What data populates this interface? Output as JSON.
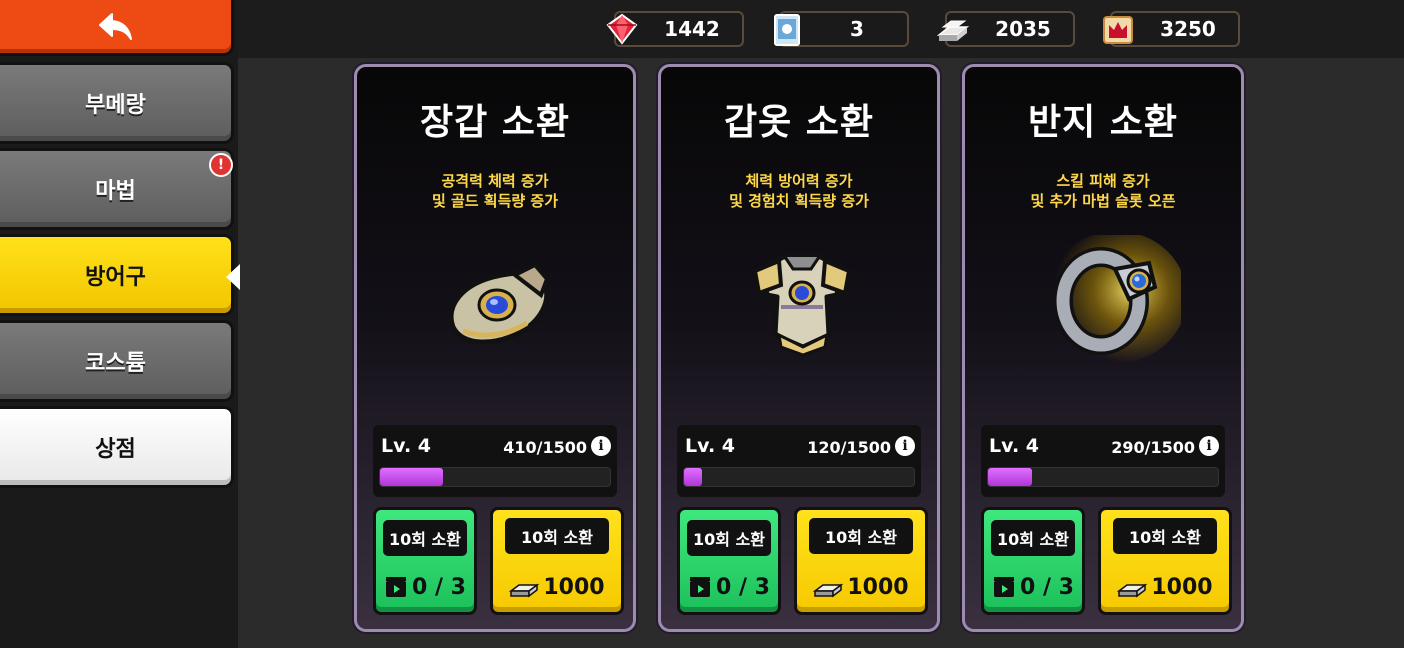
{
  "sidebar": {
    "back_icon": "back-arrow-icon",
    "tabs": [
      {
        "label": "부메랑",
        "style": "gray",
        "alert": false
      },
      {
        "label": "마법",
        "style": "gray",
        "alert": true,
        "alert_text": "!"
      },
      {
        "label": "방어구",
        "style": "yellow",
        "alert": false
      },
      {
        "label": "코스튬",
        "style": "gray",
        "alert": false
      },
      {
        "label": "상점",
        "style": "white",
        "alert": false
      }
    ]
  },
  "currencies": [
    {
      "icon": "red-gem-icon",
      "value": "1442"
    },
    {
      "icon": "summon-ticket-icon",
      "value": "3"
    },
    {
      "icon": "silver-ingot-icon",
      "value": "2035"
    },
    {
      "icon": "crown-ticket-icon",
      "value": "3250"
    }
  ],
  "cards": [
    {
      "title": "장갑 소환",
      "desc_line1": "공격력 체력 증가",
      "desc_line2": "및 골드 획득량 증가",
      "art_icon": "gauntlet-icon",
      "level": "Lv. 4",
      "progress": "410/1500",
      "progress_fraction": 0.273,
      "ad_button_label": "10회 소환",
      "ad_count": "0 / 3",
      "buy_button_label": "10회 소환",
      "buy_cost": "1000"
    },
    {
      "title": "갑옷 소환",
      "desc_line1": "체력 방어력 증가",
      "desc_line2": "및 경험치 획득량 증가",
      "art_icon": "armor-icon",
      "level": "Lv. 4",
      "progress": "120/1500",
      "progress_fraction": 0.08,
      "ad_button_label": "10회 소환",
      "ad_count": "0 / 3",
      "buy_button_label": "10회 소환",
      "buy_cost": "1000"
    },
    {
      "title": "반지 소환",
      "desc_line1": "스킬 피해 증가",
      "desc_line2": "및 추가 마법 슬롯 오픈",
      "art_icon": "ring-icon",
      "level": "Lv. 4",
      "progress": "290/1500",
      "progress_fraction": 0.193,
      "ad_button_label": "10회 소환",
      "ad_count": "0 / 3",
      "buy_button_label": "10회 소환",
      "buy_cost": "1000"
    }
  ],
  "colors": {
    "back_button": "#ee4a14",
    "selected_tab": "#f2c500",
    "card_border": "#9d8bb0",
    "desc_text": "#ffd84a",
    "progress_fill": "#c94ae8",
    "ad_button": "#1cc05a",
    "buy_button": "#f6c900"
  }
}
